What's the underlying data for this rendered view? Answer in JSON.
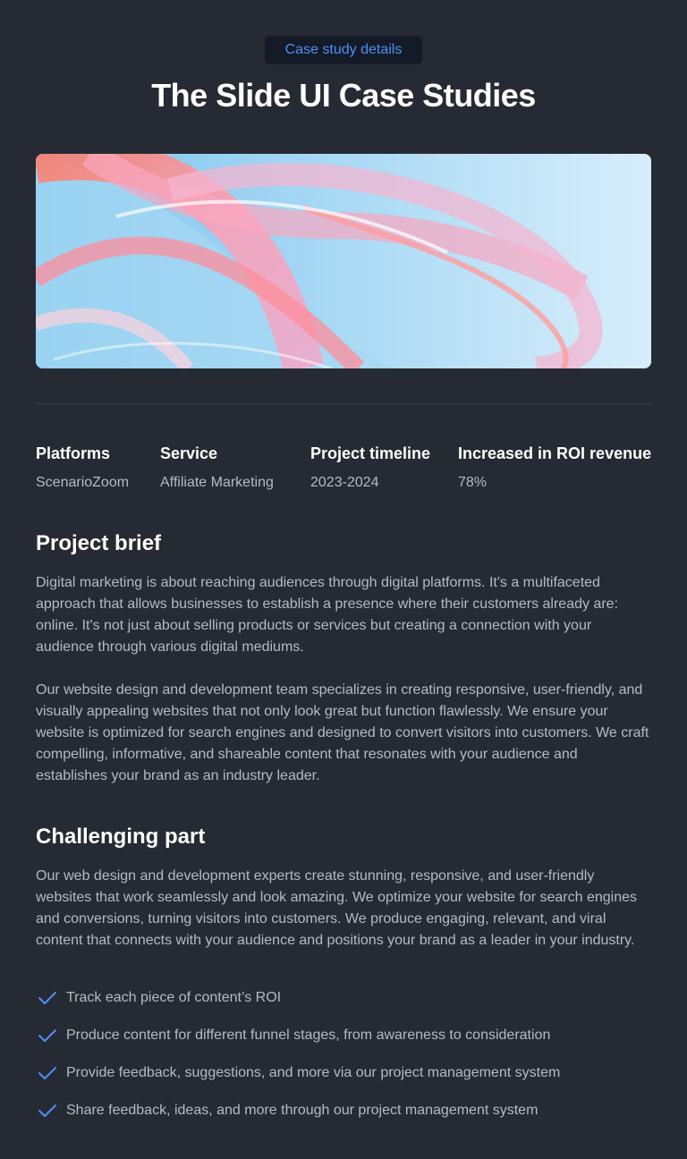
{
  "header": {
    "badge": "Case study details",
    "title": "The Slide UI Case Studies"
  },
  "hero": {
    "image": "abstract-glass-waves-image"
  },
  "stats": [
    {
      "label": "Platforms",
      "value": "ScenarioZoom"
    },
    {
      "label": "Service",
      "value": "Affiliate Marketing"
    },
    {
      "label": "Project timeline",
      "value": "2023-2024"
    },
    {
      "label": "Increased in ROI revenue",
      "value": "78%"
    }
  ],
  "brief": {
    "title": "Project brief",
    "paragraphs": [
      "Digital marketing is about reaching audiences through digital platforms. It's a multifaceted approach that allows businesses to establish a presence where their customers already are: online. It's not just about selling products or services but creating a connection with your audience through various digital mediums.",
      "Our website design and development team specializes in creating responsive, user-friendly, and visually appealing websites that not only look great but function flawlessly. We ensure your website is optimized for search engines and designed to convert visitors into customers.  We craft compelling, informative, and shareable content that resonates with your audience and establishes your brand as an industry leader."
    ]
  },
  "challenge": {
    "title": "Challenging part",
    "paragraph": "Our web design and development experts create stunning, responsive, and user-friendly websites that work seamlessly and look amazing. We optimize your website for search engines and conversions, turning visitors into customers. We produce engaging, relevant, and viral content that connects with your audience and positions your brand as a leader in your industry.",
    "items": [
      "Track each piece of content’s ROI",
      "Produce content for different funnel stages, from awareness to consideration",
      "Provide feedback, suggestions, and more via our project management system",
      "Share feedback, ideas, and more through our project management system"
    ]
  },
  "colors": {
    "background": "#262a32",
    "accent": "#4f8ff7",
    "check": "#4f8ff7"
  }
}
